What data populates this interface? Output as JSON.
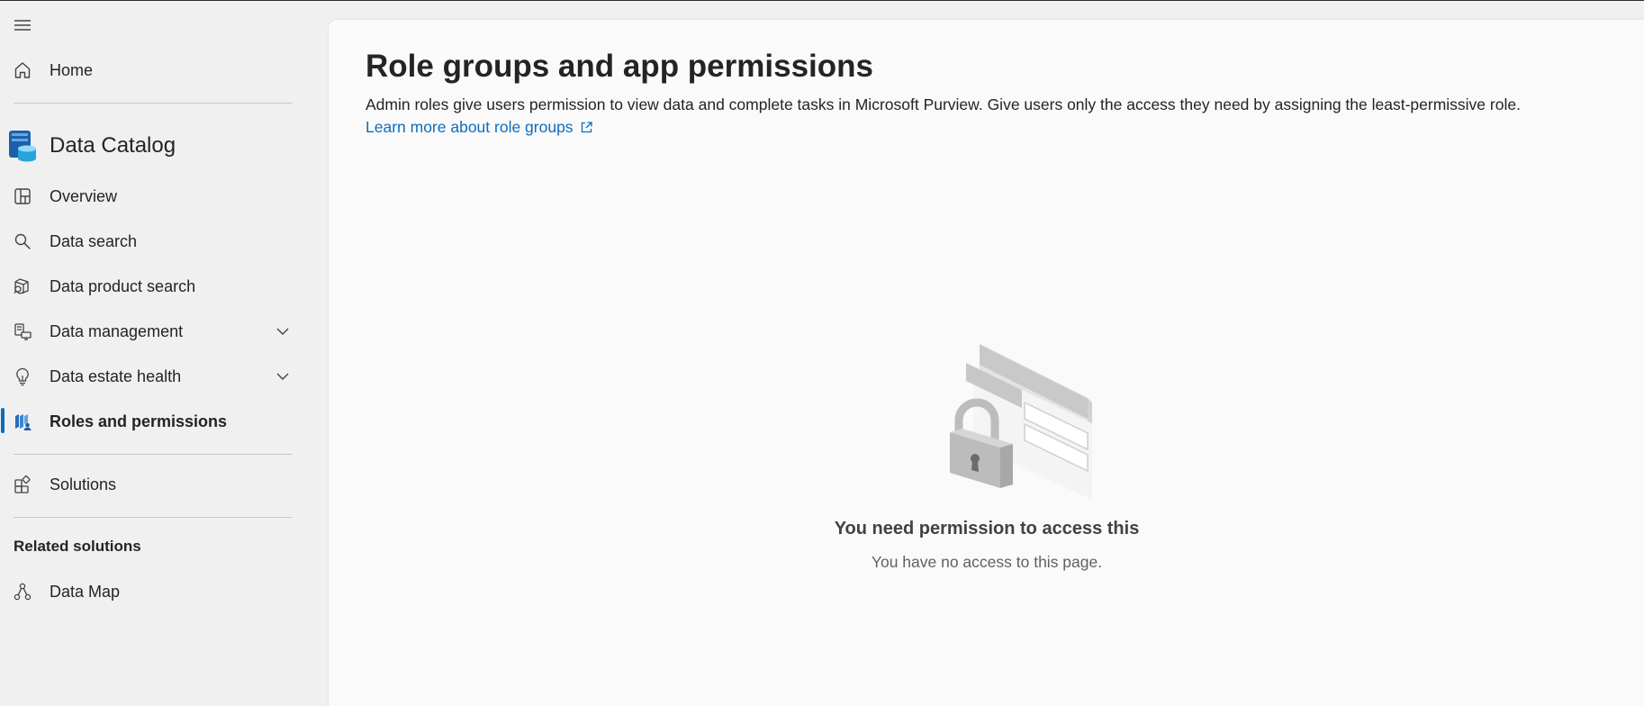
{
  "sidebar": {
    "home": "Home",
    "app_title": "Data Catalog",
    "items": [
      {
        "label": "Overview"
      },
      {
        "label": "Data search"
      },
      {
        "label": "Data product search"
      },
      {
        "label": "Data management"
      },
      {
        "label": "Data estate health"
      },
      {
        "label": "Roles and permissions"
      }
    ],
    "solutions": "Solutions",
    "related_heading": "Related solutions",
    "related_items": [
      {
        "label": "Data Map"
      }
    ],
    "active_item": "Roles and permissions"
  },
  "main": {
    "title": "Role groups and app permissions",
    "description": "Admin roles give users permission to view data and complete tasks in Microsoft Purview. Give users only the access they need by assigning the least-permissive role.",
    "learn_more": "Learn more about role groups",
    "empty_title": "You need permission to access this",
    "empty_subtitle": "You have no access to this page."
  },
  "colors": {
    "accent": "#0f6cbd",
    "sidebar_bg": "#f0f0f0",
    "content_bg": "#fafafa"
  },
  "icons": [
    "hamburger-icon",
    "home-icon",
    "data-catalog-logo-icon",
    "overview-icon",
    "search-icon",
    "data-product-search-icon",
    "data-management-icon",
    "data-estate-health-icon",
    "roles-permissions-icon",
    "solutions-icon",
    "data-map-icon",
    "chevron-down-icon",
    "external-link-icon",
    "lock-illustration-icon"
  ]
}
